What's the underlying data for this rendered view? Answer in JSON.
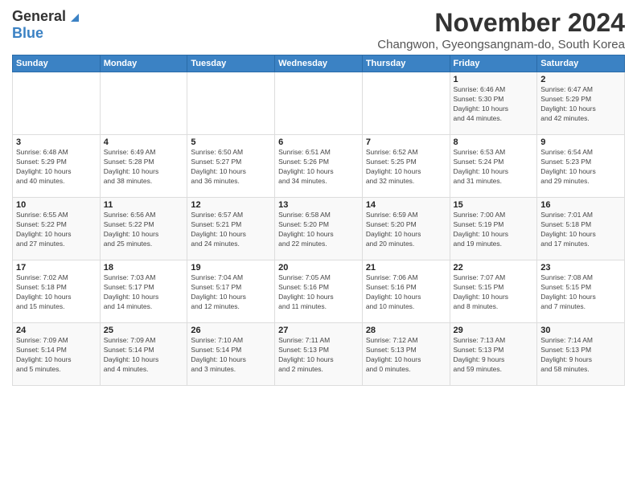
{
  "header": {
    "logo_general": "General",
    "logo_blue": "Blue",
    "title": "November 2024",
    "subtitle": "Changwon, Gyeongsangnam-do, South Korea"
  },
  "days_of_week": [
    "Sunday",
    "Monday",
    "Tuesday",
    "Wednesday",
    "Thursday",
    "Friday",
    "Saturday"
  ],
  "weeks": [
    [
      {
        "day": "",
        "info": ""
      },
      {
        "day": "",
        "info": ""
      },
      {
        "day": "",
        "info": ""
      },
      {
        "day": "",
        "info": ""
      },
      {
        "day": "",
        "info": ""
      },
      {
        "day": "1",
        "info": "Sunrise: 6:46 AM\nSunset: 5:30 PM\nDaylight: 10 hours\nand 44 minutes."
      },
      {
        "day": "2",
        "info": "Sunrise: 6:47 AM\nSunset: 5:29 PM\nDaylight: 10 hours\nand 42 minutes."
      }
    ],
    [
      {
        "day": "3",
        "info": "Sunrise: 6:48 AM\nSunset: 5:29 PM\nDaylight: 10 hours\nand 40 minutes."
      },
      {
        "day": "4",
        "info": "Sunrise: 6:49 AM\nSunset: 5:28 PM\nDaylight: 10 hours\nand 38 minutes."
      },
      {
        "day": "5",
        "info": "Sunrise: 6:50 AM\nSunset: 5:27 PM\nDaylight: 10 hours\nand 36 minutes."
      },
      {
        "day": "6",
        "info": "Sunrise: 6:51 AM\nSunset: 5:26 PM\nDaylight: 10 hours\nand 34 minutes."
      },
      {
        "day": "7",
        "info": "Sunrise: 6:52 AM\nSunset: 5:25 PM\nDaylight: 10 hours\nand 32 minutes."
      },
      {
        "day": "8",
        "info": "Sunrise: 6:53 AM\nSunset: 5:24 PM\nDaylight: 10 hours\nand 31 minutes."
      },
      {
        "day": "9",
        "info": "Sunrise: 6:54 AM\nSunset: 5:23 PM\nDaylight: 10 hours\nand 29 minutes."
      }
    ],
    [
      {
        "day": "10",
        "info": "Sunrise: 6:55 AM\nSunset: 5:22 PM\nDaylight: 10 hours\nand 27 minutes."
      },
      {
        "day": "11",
        "info": "Sunrise: 6:56 AM\nSunset: 5:22 PM\nDaylight: 10 hours\nand 25 minutes."
      },
      {
        "day": "12",
        "info": "Sunrise: 6:57 AM\nSunset: 5:21 PM\nDaylight: 10 hours\nand 24 minutes."
      },
      {
        "day": "13",
        "info": "Sunrise: 6:58 AM\nSunset: 5:20 PM\nDaylight: 10 hours\nand 22 minutes."
      },
      {
        "day": "14",
        "info": "Sunrise: 6:59 AM\nSunset: 5:20 PM\nDaylight: 10 hours\nand 20 minutes."
      },
      {
        "day": "15",
        "info": "Sunrise: 7:00 AM\nSunset: 5:19 PM\nDaylight: 10 hours\nand 19 minutes."
      },
      {
        "day": "16",
        "info": "Sunrise: 7:01 AM\nSunset: 5:18 PM\nDaylight: 10 hours\nand 17 minutes."
      }
    ],
    [
      {
        "day": "17",
        "info": "Sunrise: 7:02 AM\nSunset: 5:18 PM\nDaylight: 10 hours\nand 15 minutes."
      },
      {
        "day": "18",
        "info": "Sunrise: 7:03 AM\nSunset: 5:17 PM\nDaylight: 10 hours\nand 14 minutes."
      },
      {
        "day": "19",
        "info": "Sunrise: 7:04 AM\nSunset: 5:17 PM\nDaylight: 10 hours\nand 12 minutes."
      },
      {
        "day": "20",
        "info": "Sunrise: 7:05 AM\nSunset: 5:16 PM\nDaylight: 10 hours\nand 11 minutes."
      },
      {
        "day": "21",
        "info": "Sunrise: 7:06 AM\nSunset: 5:16 PM\nDaylight: 10 hours\nand 10 minutes."
      },
      {
        "day": "22",
        "info": "Sunrise: 7:07 AM\nSunset: 5:15 PM\nDaylight: 10 hours\nand 8 minutes."
      },
      {
        "day": "23",
        "info": "Sunrise: 7:08 AM\nSunset: 5:15 PM\nDaylight: 10 hours\nand 7 minutes."
      }
    ],
    [
      {
        "day": "24",
        "info": "Sunrise: 7:09 AM\nSunset: 5:14 PM\nDaylight: 10 hours\nand 5 minutes."
      },
      {
        "day": "25",
        "info": "Sunrise: 7:09 AM\nSunset: 5:14 PM\nDaylight: 10 hours\nand 4 minutes."
      },
      {
        "day": "26",
        "info": "Sunrise: 7:10 AM\nSunset: 5:14 PM\nDaylight: 10 hours\nand 3 minutes."
      },
      {
        "day": "27",
        "info": "Sunrise: 7:11 AM\nSunset: 5:13 PM\nDaylight: 10 hours\nand 2 minutes."
      },
      {
        "day": "28",
        "info": "Sunrise: 7:12 AM\nSunset: 5:13 PM\nDaylight: 10 hours\nand 0 minutes."
      },
      {
        "day": "29",
        "info": "Sunrise: 7:13 AM\nSunset: 5:13 PM\nDaylight: 9 hours\nand 59 minutes."
      },
      {
        "day": "30",
        "info": "Sunrise: 7:14 AM\nSunset: 5:13 PM\nDaylight: 9 hours\nand 58 minutes."
      }
    ]
  ]
}
